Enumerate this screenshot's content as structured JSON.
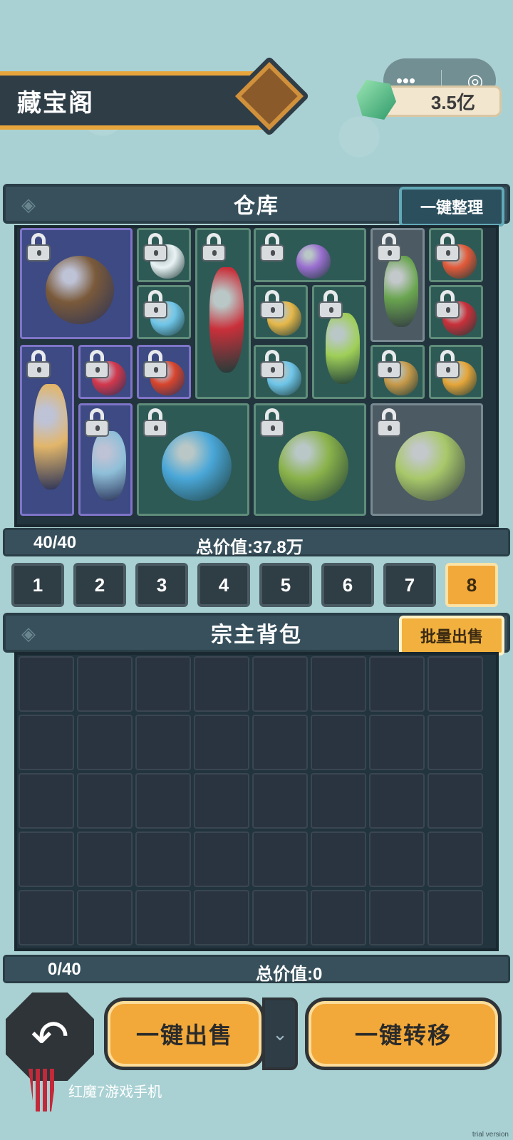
{
  "header": {
    "title": "藏宝阁",
    "currency_value": "3.5亿",
    "currency_icon": "jade-gem-icon",
    "capsule_more": "•••",
    "capsule_close": "◎"
  },
  "warehouse": {
    "title": "仓库",
    "sort_button": "一键整理",
    "count": "40/40",
    "total_value": "总价值:37.8万",
    "items": [
      {
        "name": "dark-pills-on-paper-item",
        "locked": true
      },
      {
        "name": "white-flower-item",
        "locked": true
      },
      {
        "name": "ice-leaf-item",
        "locked": true
      },
      {
        "name": "red-chili-leaf-item",
        "locked": true
      },
      {
        "name": "purple-lily-item",
        "locked": true
      },
      {
        "name": "yellow-mushroom-item",
        "locked": true
      },
      {
        "name": "yellow-herb-stem-item",
        "locked": true
      },
      {
        "name": "green-vine-item",
        "locked": true
      },
      {
        "name": "red-fruit-item",
        "locked": true
      },
      {
        "name": "red-maple-leaf-item",
        "locked": true
      },
      {
        "name": "mandrake-root-item",
        "locked": true
      },
      {
        "name": "raspberry-item",
        "locked": true
      },
      {
        "name": "red-orb-on-stand-item",
        "locked": true
      },
      {
        "name": "blue-orb-item",
        "locked": true
      },
      {
        "name": "golden-ball-on-stand-item",
        "locked": true
      },
      {
        "name": "amber-pearl-item",
        "locked": true
      },
      {
        "name": "blue-coral-branch-item",
        "locked": true
      },
      {
        "name": "blue-gourd-item",
        "locked": true
      },
      {
        "name": "ginseng-on-leaf-item",
        "locked": true
      },
      {
        "name": "bamboo-milk-item",
        "locked": true
      }
    ]
  },
  "tabs": [
    "1",
    "2",
    "3",
    "4",
    "5",
    "6",
    "7",
    "8"
  ],
  "active_tab": "8",
  "bag": {
    "title": "宗主背包",
    "sell_button": "批量出售",
    "count": "0/40",
    "total_value": "总价值:0"
  },
  "bottom": {
    "back_icon": "back-arrow-icon",
    "sell_all": "一键出售",
    "transfer_all": "一键转移"
  },
  "watermark": {
    "text": "红魔7游戏手机",
    "trial": "trial version"
  },
  "colors": {
    "accent_orange": "#f2a93a",
    "panel_dark": "#37505c",
    "background": "#a9d1d3"
  }
}
